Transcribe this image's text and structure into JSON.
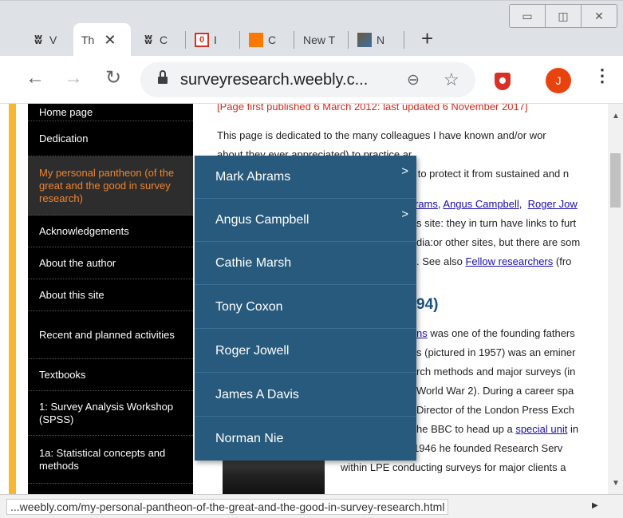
{
  "tabs": [
    {
      "title": "V",
      "favicon": "weebly-icon"
    },
    {
      "title": "Th",
      "favicon": "none",
      "active": true
    },
    {
      "title": "C",
      "favicon": "weebly-icon"
    },
    {
      "title": "I",
      "favicon": "gmail-icon",
      "badge": "0"
    },
    {
      "title": "C",
      "favicon": "orange-icon"
    },
    {
      "title": "New T",
      "favicon": "none"
    },
    {
      "title": "N",
      "favicon": "image-icon"
    }
  ],
  "toolbar": {
    "url": "surveyresearch.weebly.c...",
    "avatar_letter": "J"
  },
  "sidebar": {
    "items": [
      {
        "label": "Home page"
      },
      {
        "label": "Dedication"
      },
      {
        "label": "My personal pantheon (of the great and the good in survey research)",
        "active": true
      },
      {
        "label": "Acknowledgements"
      },
      {
        "label": "About the author"
      },
      {
        "label": "About this site"
      },
      {
        "label": "Recent and planned activities"
      },
      {
        "label": "Textbooks"
      },
      {
        "label": "1: Survey Analysis Workshop (SPSS)"
      },
      {
        "label": "1a: Statistical concepts and methods"
      }
    ]
  },
  "dropdown": {
    "items": [
      {
        "label": "Mark Abrams",
        "has_submenu": true
      },
      {
        "label": "Angus Campbell",
        "has_submenu": true
      },
      {
        "label": "Cathie Marsh",
        "has_submenu": false
      },
      {
        "label": "Tony Coxon",
        "has_submenu": false
      },
      {
        "label": "Roger Jowell",
        "has_submenu": false
      },
      {
        "label": "James A Davis",
        "has_submenu": false
      },
      {
        "label": "Norman Nie",
        "has_submenu": false
      }
    ]
  },
  "content": {
    "published_line": "[Page first published 6 March 2012: last updated 6 November 2017]",
    "para1_line1": "This page is dedicated to the many colleagues I have known and/or wor",
    "para1_line2_a": "about ",
    "para1_line2_b": "they ever appreciated) to practice ar",
    "para1_line3": "s, to protect it from sustained and n",
    "links_line_link1": "rams",
    "links_line_link2": "Angus Campbell",
    "links_line_link3": "Roger Jow",
    "line5": "s site: they in turn have links to furt",
    "line6": "dia:or other sites, but there are som",
    "line7_text": ".  See also ",
    "line7_link": "Fellow researchers",
    "line7_end": " (fro",
    "heading": "94)",
    "bio_link": "ns",
    "bio_line1": " was one of the founding fathers",
    "bio_line2": "s (pictured in 1957) was an eminer",
    "bio_line3": "rch methods and major surveys (in",
    "bio_line4": "World War 2).  During a career spa",
    "bio_line5": "Director of the London Press Exch",
    "bio_line6_a": "he BBC to head up a ",
    "bio_line6_link": "special unit",
    "bio_line6_b": " in",
    "bio_line7": "propaganda.  In 1946 he  founded Research Serv",
    "bio_line8": "within LPE conducting surveys for major clients a"
  },
  "status": {
    "url": "...weebly.com/my-personal-pantheon-of-the-great-and-the-good-in-survey-research.html"
  }
}
